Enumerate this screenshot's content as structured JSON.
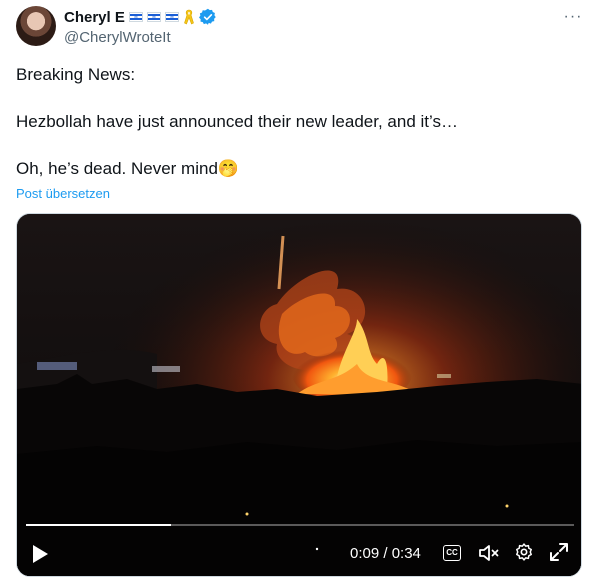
{
  "author": {
    "display_name": "Cheryl E",
    "handle": "@CherylWroteIt"
  },
  "tweet": {
    "lines": [
      "Breaking News:",
      "Hezbollah have just announced their new leader, and it’s…",
      "Oh, he’s dead. Never mind🤭"
    ],
    "translate_label": "Post übersetzen",
    "more_label": "···"
  },
  "video": {
    "time_label": "0:09 / 0:34",
    "cc_label": "CC",
    "progress": 0.265
  },
  "colors": {
    "link": "#1d9bf0",
    "verified": "#1d9bf0",
    "secondary_text": "#536471"
  },
  "icons": [
    "israel-flag-icon",
    "yellow-ribbon-icon",
    "verified-badge-icon",
    "more-icon",
    "play-icon",
    "captions-icon",
    "muted-speaker-icon",
    "settings-gear-icon",
    "fullscreen-icon"
  ]
}
